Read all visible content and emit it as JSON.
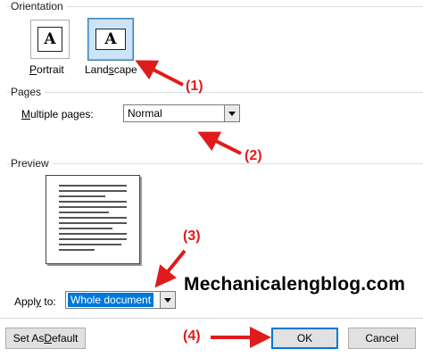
{
  "orientation": {
    "title": "Orientation",
    "portrait_label": "Portrait",
    "landscape_label": "Landscape",
    "icon_letter": "A",
    "selected": "Landscape"
  },
  "pages": {
    "title": "Pages",
    "multiple_pages_label": "Multiple pages:",
    "multiple_pages_value": "Normal"
  },
  "preview": {
    "title": "Preview"
  },
  "apply": {
    "label": "Apply to:",
    "value": "Whole document"
  },
  "buttons": {
    "set_default": "Set As Default",
    "ok": "OK",
    "cancel": "Cancel"
  },
  "annotations": {
    "a1": "(1)",
    "a2": "(2)",
    "a3": "(3)",
    "a4": "(4)",
    "color": "#e01b1b"
  },
  "watermark": "Mechanicalengblog.com"
}
